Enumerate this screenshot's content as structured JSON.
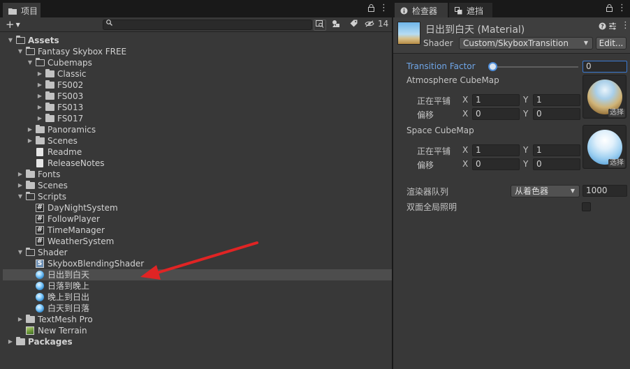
{
  "project": {
    "tab_label": "项目",
    "hidden_count": "14",
    "tree": [
      {
        "label": "Assets",
        "depth": 0,
        "expanded": true,
        "icon": "folder-open",
        "bold": true
      },
      {
        "label": "Fantasy Skybox FREE",
        "depth": 1,
        "expanded": true,
        "icon": "folder-open"
      },
      {
        "label": "Cubemaps",
        "depth": 2,
        "expanded": true,
        "icon": "folder-open"
      },
      {
        "label": "Classic",
        "depth": 3,
        "expanded": false,
        "icon": "folder"
      },
      {
        "label": "FS002",
        "depth": 3,
        "expanded": false,
        "icon": "folder"
      },
      {
        "label": "FS003",
        "depth": 3,
        "expanded": false,
        "icon": "folder"
      },
      {
        "label": "FS013",
        "depth": 3,
        "expanded": false,
        "icon": "folder"
      },
      {
        "label": "FS017",
        "depth": 3,
        "expanded": false,
        "icon": "folder"
      },
      {
        "label": "Panoramics",
        "depth": 2,
        "expanded": false,
        "icon": "folder"
      },
      {
        "label": "Scenes",
        "depth": 2,
        "expanded": false,
        "icon": "folder"
      },
      {
        "label": "Readme",
        "depth": 2,
        "icon": "document"
      },
      {
        "label": "ReleaseNotes",
        "depth": 2,
        "icon": "document"
      },
      {
        "label": "Fonts",
        "depth": 1,
        "expanded": false,
        "icon": "folder"
      },
      {
        "label": "Scenes",
        "depth": 1,
        "expanded": false,
        "icon": "folder"
      },
      {
        "label": "Scripts",
        "depth": 1,
        "expanded": true,
        "icon": "folder-open"
      },
      {
        "label": "DayNightSystem",
        "depth": 2,
        "icon": "script"
      },
      {
        "label": "FollowPlayer",
        "depth": 2,
        "icon": "script"
      },
      {
        "label": "TimeManager",
        "depth": 2,
        "icon": "script"
      },
      {
        "label": "WeatherSystem",
        "depth": 2,
        "icon": "script"
      },
      {
        "label": "Shader",
        "depth": 1,
        "expanded": true,
        "icon": "folder-open"
      },
      {
        "label": "SkyboxBlendingShader",
        "depth": 2,
        "icon": "shader"
      },
      {
        "label": "日出到白天",
        "depth": 2,
        "icon": "material",
        "selected": true
      },
      {
        "label": "日落到晚上",
        "depth": 2,
        "icon": "material"
      },
      {
        "label": "晚上到日出",
        "depth": 2,
        "icon": "material"
      },
      {
        "label": "白天到日落",
        "depth": 2,
        "icon": "material"
      },
      {
        "label": "TextMesh Pro",
        "depth": 1,
        "expanded": false,
        "icon": "folder"
      },
      {
        "label": "New Terrain",
        "depth": 1,
        "icon": "terrain"
      },
      {
        "label": "Packages",
        "depth": 0,
        "expanded": false,
        "icon": "folder",
        "bold": true
      }
    ]
  },
  "inspector": {
    "tab_inspector_label": "检查器",
    "tab_occlusion_label": "遮挡",
    "title": "日出到白天 (Material)",
    "shader_label": "Shader",
    "shader_value": "Custom/SkyboxTransition",
    "edit_button": "Edit...",
    "transition_label": "Transition Factor",
    "transition_value": "0",
    "transition_fraction": 0,
    "atmosphere": {
      "label": "Atmosphere CubeMap",
      "tiling_label": "正在平铺",
      "offset_label": "偏移",
      "tiling_x": "1",
      "tiling_y": "1",
      "offset_x": "0",
      "offset_y": "0",
      "select_label": "选择"
    },
    "space": {
      "label": "Space CubeMap",
      "tiling_label": "正在平铺",
      "offset_label": "偏移",
      "tiling_x": "1",
      "tiling_y": "1",
      "offset_x": "0",
      "offset_y": "0",
      "select_label": "选择"
    },
    "axis_x": "X",
    "axis_y": "Y",
    "render_queue_label": "渲染器队列",
    "render_queue_option": "从着色器",
    "render_queue_value": "1000",
    "double_sided_gi_label": "双面全局照明",
    "double_sided_gi_checked": false
  },
  "colors": {
    "panel_bg": "#383838",
    "selection": "#4d4d4d",
    "accent_blue": "#4f8fdc",
    "annotation_red": "#e02424"
  }
}
